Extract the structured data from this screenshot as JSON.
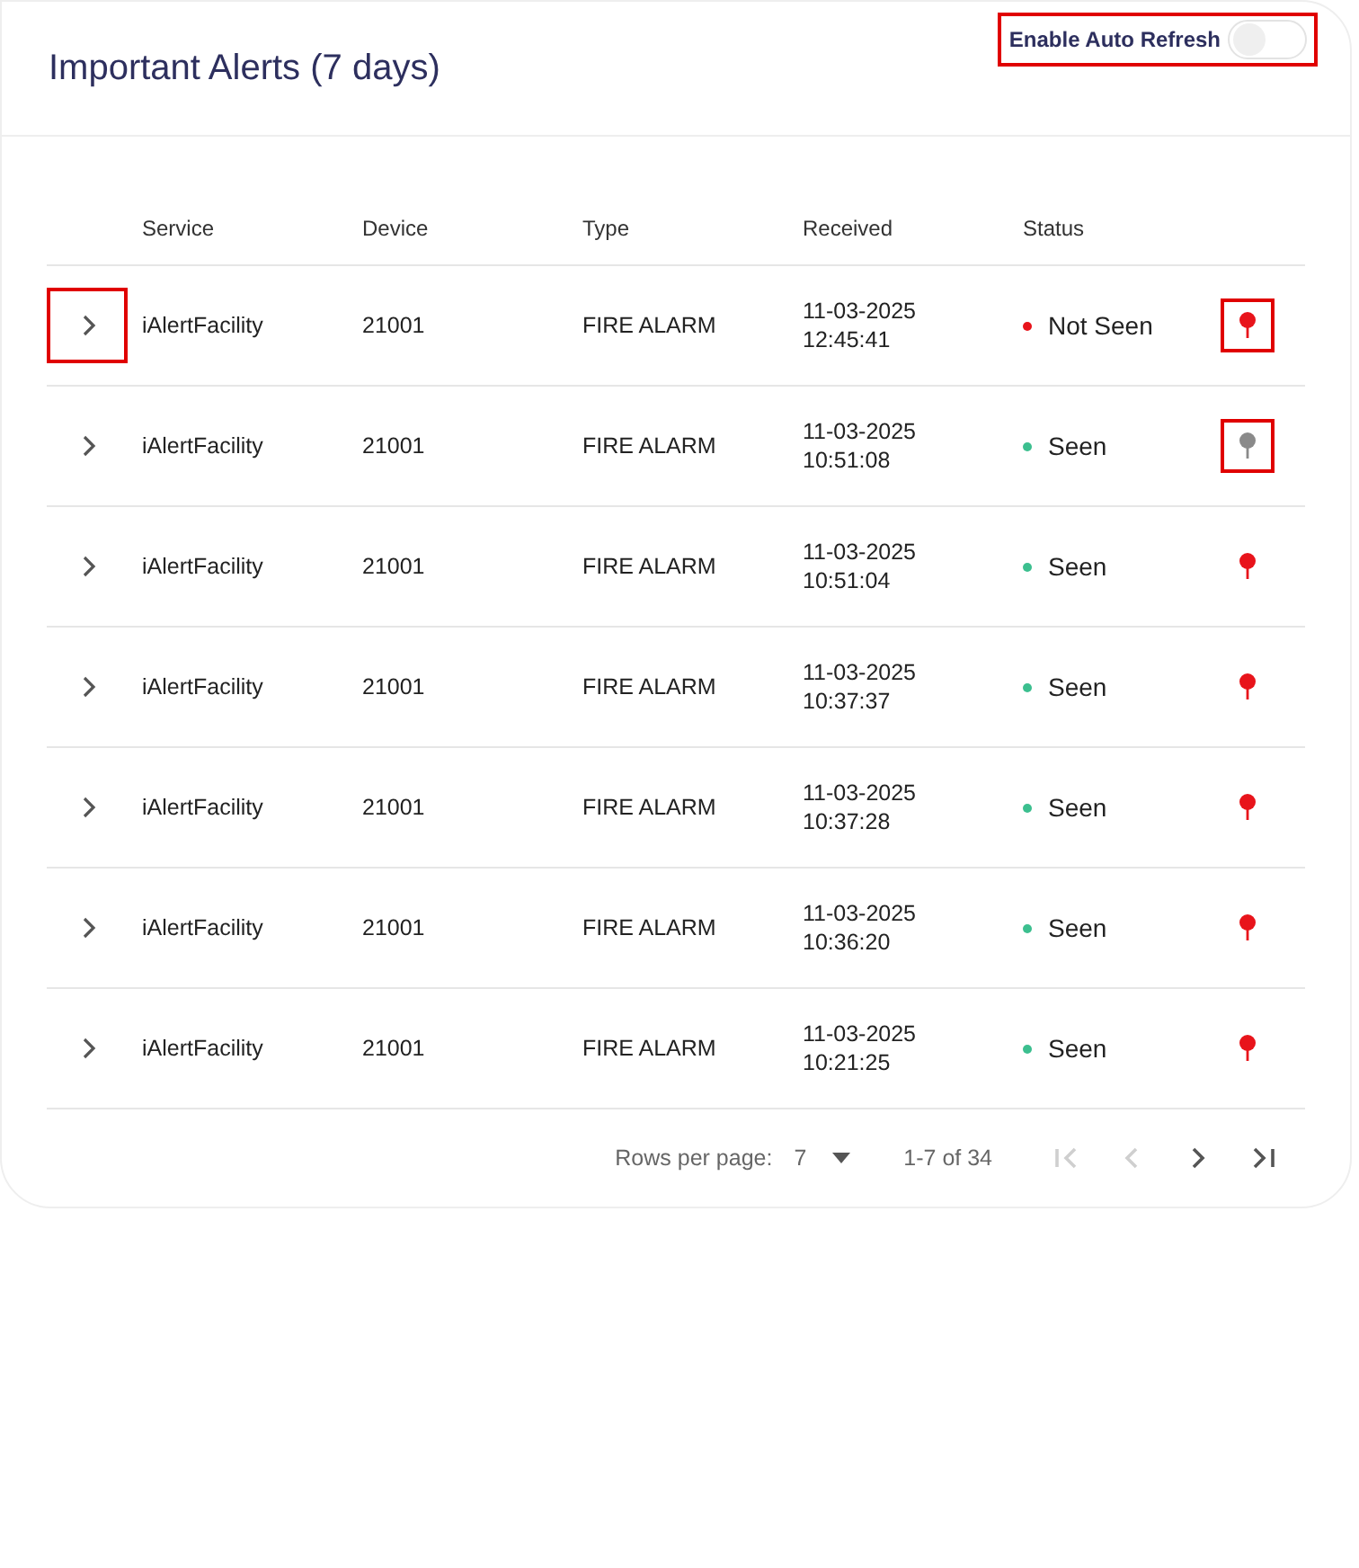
{
  "header": {
    "title": "Important Alerts (7 days)",
    "auto_refresh": {
      "label": "Enable Auto Refresh",
      "on": false,
      "highlighted": true
    }
  },
  "table": {
    "columns": [
      "Service",
      "Device",
      "Type",
      "Received",
      "Status"
    ],
    "rows": [
      {
        "service": "iAlertFacility",
        "device": "21001",
        "type": "FIRE ALARM",
        "date": "11-03-2025",
        "time": "12:45:41",
        "status": "Not Seen",
        "color": "#e8141b",
        "pin": {
          "color": "#e8141b",
          "highlighted": true
        },
        "expand_highlighted": true
      },
      {
        "service": "iAlertFacility",
        "device": "21001",
        "type": "FIRE ALARM",
        "date": "11-03-2025",
        "time": "10:51:08",
        "status": "Seen",
        "color": "#3cbf8f",
        "pin": {
          "color": "#8a8a8a",
          "highlighted": true
        },
        "expand_highlighted": false
      },
      {
        "service": "iAlertFacility",
        "device": "21001",
        "type": "FIRE ALARM",
        "date": "11-03-2025",
        "time": "10:51:04",
        "status": "Seen",
        "color": "#3cbf8f",
        "pin": {
          "color": "#e8141b",
          "highlighted": false
        },
        "expand_highlighted": false
      },
      {
        "service": "iAlertFacility",
        "device": "21001",
        "type": "FIRE ALARM",
        "date": "11-03-2025",
        "time": "10:37:37",
        "status": "Seen",
        "color": "#3cbf8f",
        "pin": {
          "color": "#e8141b",
          "highlighted": false
        },
        "expand_highlighted": false
      },
      {
        "service": "iAlertFacility",
        "device": "21001",
        "type": "FIRE ALARM",
        "date": "11-03-2025",
        "time": "10:37:28",
        "status": "Seen",
        "color": "#3cbf8f",
        "pin": {
          "color": "#e8141b",
          "highlighted": false
        },
        "expand_highlighted": false
      },
      {
        "service": "iAlertFacility",
        "device": "21001",
        "type": "FIRE ALARM",
        "date": "11-03-2025",
        "time": "10:36:20",
        "status": "Seen",
        "color": "#3cbf8f",
        "pin": {
          "color": "#e8141b",
          "highlighted": false
        },
        "expand_highlighted": false
      },
      {
        "service": "iAlertFacility",
        "device": "21001",
        "type": "FIRE ALARM",
        "date": "11-03-2025",
        "time": "10:21:25",
        "status": "Seen",
        "color": "#3cbf8f",
        "pin": {
          "color": "#e8141b",
          "highlighted": false
        },
        "expand_highlighted": false
      }
    ]
  },
  "pagination": {
    "rows_per_page_label": "Rows per page:",
    "rows_per_page": "7",
    "range": "1-7 of 34",
    "first_disabled": true,
    "prev_disabled": true,
    "next_disabled": false,
    "last_disabled": false
  }
}
